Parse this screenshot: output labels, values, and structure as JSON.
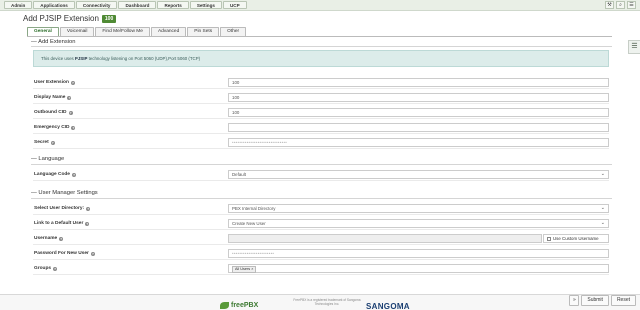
{
  "nav": [
    "Admin",
    "Applications",
    "Connectivity",
    "Dashboard",
    "Reports",
    "Settings",
    "UCP"
  ],
  "top_icons": [
    "⚒",
    "⌕",
    "☰"
  ],
  "page": {
    "title": "Add PJSIP Extension",
    "badge": "100"
  },
  "tabs": [
    "General",
    "Voicemail",
    "Find Me/Follow Me",
    "Advanced",
    "Pin Sets",
    "Other"
  ],
  "sections": {
    "add_extension": "Add Extension",
    "language": "Language",
    "user_manager": "User Manager Settings"
  },
  "info": {
    "prefix": "This device uses ",
    "tech": "PJSIP",
    "suffix": " technology listening on Port 5060 (UDP),Port 5060 (TCP)"
  },
  "fields": {
    "user_extension": {
      "label": "User Extension",
      "value": "100"
    },
    "display_name": {
      "label": "Display Name",
      "value": "100"
    },
    "outbound_cid": {
      "label": "Outbound CID",
      "value": "100"
    },
    "emergency_cid": {
      "label": "Emergency CID",
      "value": ""
    },
    "secret": {
      "label": "Secret",
      "value": "••••••••••••••••••••••••••••••"
    },
    "language_code": {
      "label": "Language Code",
      "value": "Default"
    },
    "user_directory": {
      "label": "Select User Directory:",
      "value": "PBX Internal Directory"
    },
    "link_default_user": {
      "label": "Link to a Default User",
      "value": "Create New User"
    },
    "username": {
      "label": "Username",
      "value": ""
    },
    "use_custom_username": "Use Custom Username",
    "password_new_user": {
      "label": "Password For New User",
      "value": "•••••••••••••••••••••••"
    },
    "groups": {
      "label": "Groups",
      "tag": "All Users ×"
    }
  },
  "footer": {
    "logo_left": "freePBX",
    "text": "FreePBX is a registered trademark of Sangoma Technologies Inc.",
    "logo_right": "SANGOMA",
    "submit": "Submit",
    "reset": "Reset",
    "arrow": "»"
  },
  "colors": {
    "accent": "#4f8a34",
    "info_bg": "#dcecea",
    "nav_bg": "#e9efe6"
  }
}
